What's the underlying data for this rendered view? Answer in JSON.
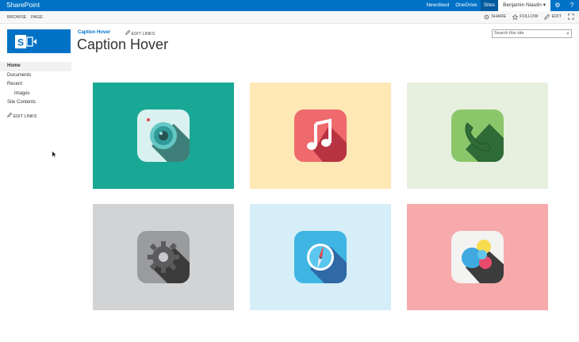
{
  "suite": {
    "brand": "SharePoint",
    "links": [
      "Newsfeed",
      "OneDrive",
      "Sites"
    ],
    "user": "Benjamin Niaulin ▾",
    "icons": [
      "gear-icon",
      "help-icon"
    ]
  },
  "ribbon": {
    "tabs": [
      "BROWSE",
      "PAGE"
    ],
    "actions": [
      {
        "label": "SHARE",
        "icon": "share-icon"
      },
      {
        "label": "FOLLOW",
        "icon": "star-icon"
      },
      {
        "label": "EDIT",
        "icon": "pencil-icon"
      }
    ]
  },
  "header": {
    "site_link": "Caption Hover",
    "edit_links": "EDIT LINKS",
    "title": "Caption Hover",
    "search_placeholder": "Search this site"
  },
  "quicklaunch": {
    "items": [
      {
        "label": "Home"
      },
      {
        "label": "Documents"
      },
      {
        "label": "Recent"
      },
      {
        "label": "Images"
      },
      {
        "label": "Site Contents"
      }
    ],
    "edit_links": "EDIT LINKS"
  },
  "tiles": [
    {
      "name": "camera",
      "bg": "#1aa896",
      "icon": "camera-icon"
    },
    {
      "name": "music",
      "bg": "#fde8b6",
      "icon": "music-note-icon"
    },
    {
      "name": "phone",
      "bg": "#e7f0df",
      "icon": "phone-icon"
    },
    {
      "name": "settings",
      "bg": "#d2d3d5",
      "icon": "gear-icon"
    },
    {
      "name": "compass",
      "bg": "#d6eef8",
      "icon": "compass-icon"
    },
    {
      "name": "game-center",
      "bg": "#f7aaab",
      "icon": "bubbles-icon"
    }
  ],
  "colors": {
    "suite": "#0072c6",
    "accent": "#0072c6"
  }
}
